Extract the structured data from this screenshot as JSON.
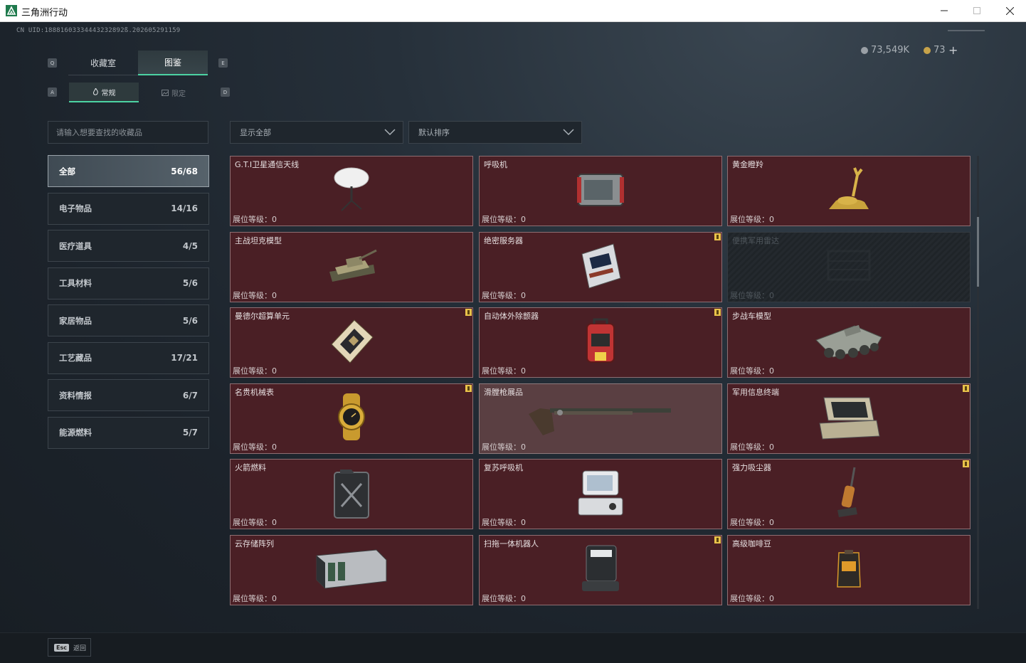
{
  "window": {
    "title": "三角洲行动"
  },
  "header": {
    "uid": "CN UID:18881603334443232892ß.202605291159",
    "currency1": "73,549K",
    "currency2": "73",
    "add_label": "+"
  },
  "tabs": [
    {
      "label": "收藏室",
      "key": "Q"
    },
    {
      "label": "图鉴",
      "key": "E"
    }
  ],
  "subtabs": [
    {
      "label": "常规",
      "key": "A"
    },
    {
      "label": "限定",
      "key": "D"
    }
  ],
  "search": {
    "placeholder": "请输入想要查找的收藏品"
  },
  "filters": {
    "show": "显示全部",
    "sort": "默认排序"
  },
  "categories": [
    {
      "label": "全部",
      "count": "56/68"
    },
    {
      "label": "电子物品",
      "count": "14/16"
    },
    {
      "label": "医疗道具",
      "count": "4/5"
    },
    {
      "label": "工具材料",
      "count": "5/6"
    },
    {
      "label": "家居物品",
      "count": "5/6"
    },
    {
      "label": "工艺藏品",
      "count": "17/21"
    },
    {
      "label": "资料情报",
      "count": "6/7"
    },
    {
      "label": "能源燃料",
      "count": "5/7"
    }
  ],
  "items": [
    {
      "name": "G.T.I卫星通信天线",
      "level": "展位等级：0",
      "icon": "satellite-dish-icon"
    },
    {
      "name": "呼吸机",
      "level": "展位等级：0",
      "icon": "ventilator-icon"
    },
    {
      "name": "黄金瞪羚",
      "level": "展位等级：0",
      "icon": "golden-gazelle-icon"
    },
    {
      "name": "主战坦克模型",
      "level": "展位等级：0",
      "icon": "tank-model-icon"
    },
    {
      "name": "绝密服务器",
      "level": "展位等级：0",
      "icon": "server-icon",
      "flag": true
    },
    {
      "name": "便携军用雷达",
      "level": "展位等级：0",
      "icon": "radar-icon",
      "locked": true
    },
    {
      "name": "曼德尔超算单元",
      "level": "展位等级：0",
      "icon": "supercomputer-unit-icon",
      "flag": true
    },
    {
      "name": "自动体外除颤器",
      "level": "展位等级：0",
      "icon": "defibrillator-icon",
      "flag": true
    },
    {
      "name": "步战车模型",
      "level": "展位等级：0",
      "icon": "ifv-model-icon"
    },
    {
      "name": "名贵机械表",
      "level": "展位等级：0",
      "icon": "watch-icon",
      "flag": true
    },
    {
      "name": "滑膛枪展品",
      "level": "展位等级：0",
      "icon": "musket-icon",
      "highlight": true
    },
    {
      "name": "军用信息终端",
      "level": "展位等级：0",
      "icon": "military-terminal-icon",
      "flag": true
    },
    {
      "name": "火箭燃料",
      "level": "展位等级：0",
      "icon": "fuel-can-icon"
    },
    {
      "name": "复苏呼吸机",
      "level": "展位等级：0",
      "icon": "resuscitator-icon"
    },
    {
      "name": "强力吸尘器",
      "level": "展位等级：0",
      "icon": "vacuum-icon",
      "flag": true
    },
    {
      "name": "云存储阵列",
      "level": "展位等级：0",
      "icon": "storage-array-icon"
    },
    {
      "name": "扫拖一体机器人",
      "level": "展位等级：0",
      "icon": "robot-vacuum-icon",
      "flag": true
    },
    {
      "name": "高级咖啡豆",
      "level": "展位等级：0",
      "icon": "coffee-beans-icon"
    }
  ],
  "footer": {
    "key": "Esc",
    "label": "返回"
  }
}
